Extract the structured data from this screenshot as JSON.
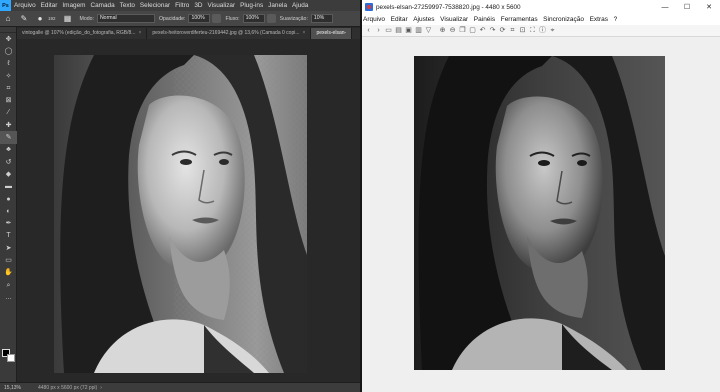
{
  "photoshop": {
    "logo": "Ps",
    "menu": [
      "Arquivo",
      "Editar",
      "Imagem",
      "Camada",
      "Texto",
      "Selecionar",
      "Filtro",
      "3D",
      "Visualizar",
      "Plug-ins",
      "Janela",
      "Ajuda"
    ],
    "options": {
      "brush_size": "192",
      "mode_label": "Modo:",
      "mode_value": "Normal",
      "opacity_label": "Opacidade:",
      "opacity_value": "100%",
      "flow_label": "Fluxo:",
      "flow_value": "100%",
      "smoothing_label": "Suavização:",
      "smoothing_value": "10%"
    },
    "tabs": [
      {
        "label": "vintogalle @ 107% (edição_do_fotografia, RGB/8...",
        "close": "×",
        "active": false
      },
      {
        "label": "pexels-heitoroverdiferteu-2169442.jpg @ 13,6% (Camada 0 copi...",
        "close": "×",
        "active": false
      },
      {
        "label": "pexels-elsan-",
        "close": "",
        "active": true
      }
    ],
    "tools": [
      "move-icon",
      "marquee-icon",
      "lasso-icon",
      "quick-select-icon",
      "crop-icon",
      "frame-icon",
      "eyedropper-icon",
      "healing-icon",
      "brush-icon",
      "stamp-icon",
      "history-brush-icon",
      "eraser-icon",
      "gradient-icon",
      "blur-icon",
      "dodge-icon",
      "pen-icon",
      "type-icon",
      "path-select-icon",
      "rectangle-icon",
      "hand-icon",
      "zoom-icon",
      "more-icon"
    ],
    "status": {
      "zoom": "15,13%",
      "doc": "4480 px x 5600 px (72 ppi)",
      "arrow": "›"
    }
  },
  "irfanview": {
    "title": "pexels-elsan-27259997-7538820.jpg - 4480 x 5600",
    "window_buttons": {
      "minimize": "—",
      "maximize": "☐",
      "close": "✕"
    },
    "menu": [
      "Arquivo",
      "Editar",
      "Ajustes",
      "Visualizar",
      "Painéis",
      "Ferramentas",
      "Sincronização",
      "Extras",
      "?"
    ],
    "toolbar": [
      "back-icon",
      "forward-icon",
      "open-icon",
      "folder-icon",
      "save-icon",
      "print-icon",
      "filter-icon",
      "zoom-in-icon",
      "zoom-out-icon",
      "copy-icon",
      "paste-icon",
      "undo-icon",
      "redo-icon",
      "rotate-icon",
      "crop-icon",
      "fit-icon",
      "fullscreen-icon",
      "info-icon",
      "location-icon"
    ]
  },
  "colors": {
    "ps_bg": "#282828",
    "ps_panel": "#3c3c3c",
    "ps_accent": "#31a8ff",
    "iv_bg": "#efefef"
  }
}
